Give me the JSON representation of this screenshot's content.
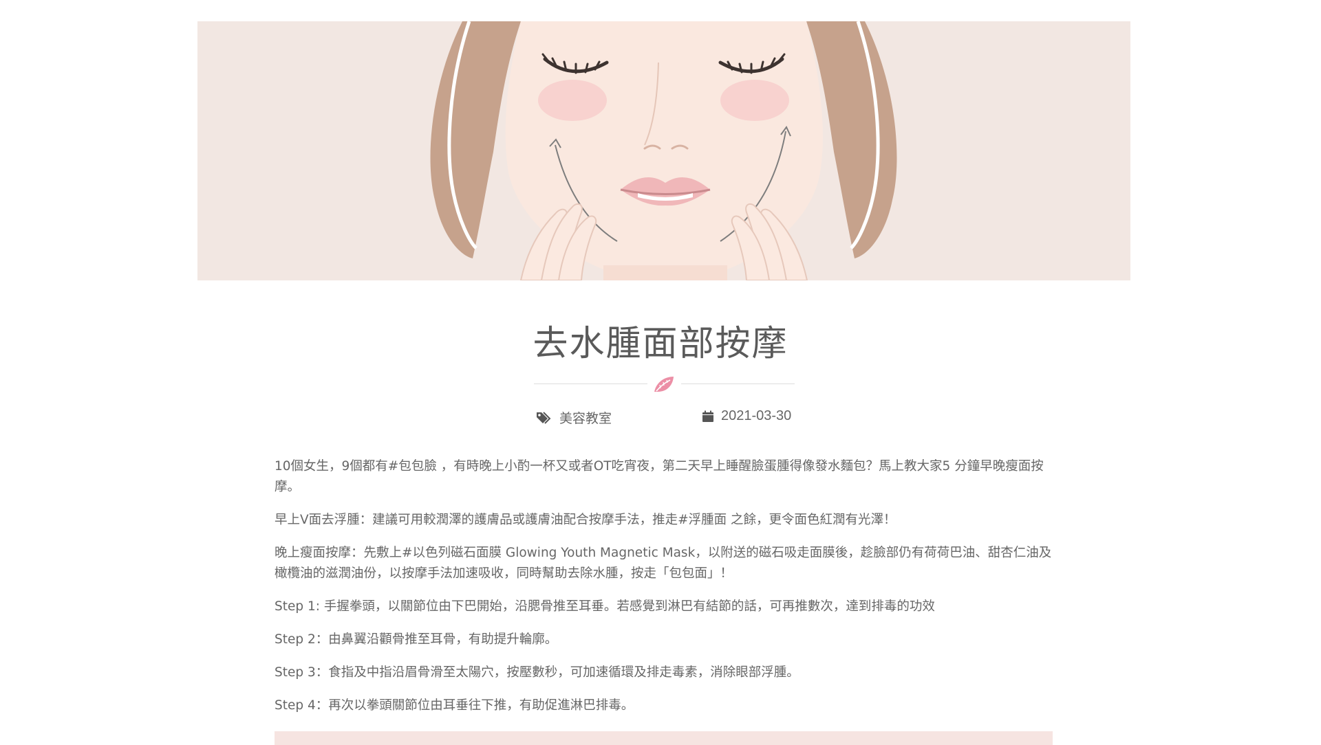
{
  "article": {
    "title": "去水腫面部按摩",
    "category": "美容教室",
    "date": "2021-03-30",
    "paragraphs": [
      "10個女生，9個都有#包包臉 ，有時晚上小酌一杯又或者OT吃宵夜，第二天早上睡醒臉蛋腫得像發水麵包？馬上教大家5 分鐘早晚瘦面按摩。",
      "早上V面去浮腫：建議可用較潤澤的護膚品或護膚油配合按摩手法，推走#浮腫面 之餘，更令面色紅潤有光澤！",
      "晚上瘦面按摩：先敷上#以色列磁石面膜 Glowing Youth Magnetic Mask，以附送的磁石吸走面膜後，趁臉部仍有荷荷巴油、甜杏仁油及橄欖油的滋潤油份，以按摩手法加速吸收，同時幫助去除水腫，按走「包包面」！",
      "Step 1: 手握拳頭，以關節位由下巴開始，沿腮骨推至耳垂。若感覺到淋巴有結節的話，可再推數次，達到排毒的功效",
      "Step 2：由鼻翼沿顴骨推至耳骨，有助提升輪廓。",
      "Step 3：食指及中指沿眉骨滑至太陽穴，按壓數秒，可加速循環及排走毒素，消除眼部浮腫。",
      "Step 4：再次以拳頭關節位由耳垂往下推，有助促進淋巴排毒。"
    ]
  },
  "icons": {
    "category": "tags-icon",
    "date": "calendar-icon",
    "divider": "leaf-icon"
  },
  "colors": {
    "accent": "#ec8fa6",
    "hero_bg": "#f2e7e2",
    "banner_bg": "#f6e4e1",
    "text": "#666666"
  }
}
